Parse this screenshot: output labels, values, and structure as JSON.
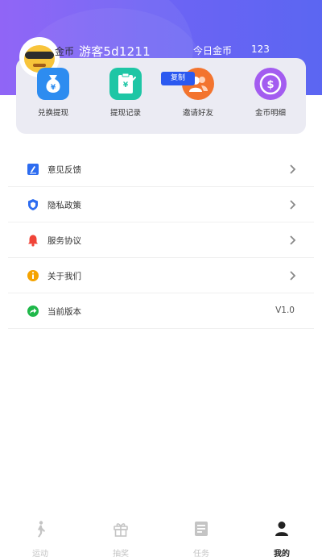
{
  "profile": {
    "coin_label": "金币",
    "username": "游客5d1211",
    "today_coins_label": "今日金币",
    "today_coins_value": "123",
    "copy_button": "复制"
  },
  "quick_actions": [
    {
      "label": "兑换提现",
      "icon": "money-bag-icon"
    },
    {
      "label": "提现记录",
      "icon": "clipboard-yen-icon"
    },
    {
      "label": "邀请好友",
      "icon": "users-icon"
    },
    {
      "label": "金币明细",
      "icon": "dollar-coin-icon"
    }
  ],
  "menu": [
    {
      "label": "意见反馈",
      "icon": "feedback-pencil-icon"
    },
    {
      "label": "隐私政策",
      "icon": "shield-icon"
    },
    {
      "label": "服务协议",
      "icon": "bell-icon"
    },
    {
      "label": "关于我们",
      "icon": "info-icon"
    },
    {
      "label": "当前版本",
      "icon": "share-arrow-icon",
      "value": "V1.0"
    }
  ],
  "tabs": [
    {
      "label": "运动",
      "icon": "walking-icon",
      "active": false
    },
    {
      "label": "抽奖",
      "icon": "gift-icon",
      "active": false
    },
    {
      "label": "任务",
      "icon": "task-list-icon",
      "active": false
    },
    {
      "label": "我的",
      "icon": "person-icon",
      "active": true
    }
  ],
  "colors": {
    "header_start": "#8a5cf6",
    "header_end": "#5b66f2",
    "card_background": "#ebebf3",
    "copy_button": "#2b59f0",
    "active_tab": "#222222",
    "inactive_tab": "#c4c4c4"
  }
}
